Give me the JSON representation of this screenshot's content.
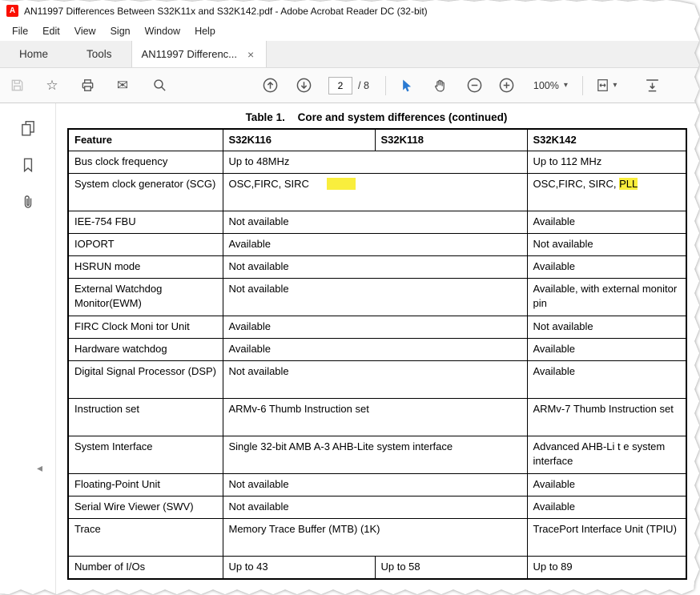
{
  "window": {
    "title": "AN11997 Differences Between S32K11x and S32K142.pdf - Adobe Acrobat Reader DC (32-bit)"
  },
  "menubar": {
    "items": [
      "File",
      "Edit",
      "View",
      "Sign",
      "Window",
      "Help"
    ]
  },
  "tabbar": {
    "home_label": "Home",
    "tools_label": "Tools",
    "document_tab_label": "AN11997 Differenc..."
  },
  "toolbar": {
    "page_current": "2",
    "page_total_label": "/ 8",
    "zoom_value": "100%"
  },
  "glyphs": {
    "star": "☆",
    "envelope": "✉",
    "caret_down": "▾",
    "collapse_left": "◂",
    "close": "×"
  },
  "document": {
    "caption_prefix": "Table 1.",
    "caption_title": "Core and system differences (continued)",
    "table": {
      "headers": [
        "Feature",
        "S32K116",
        "S32K118",
        "S32K142"
      ],
      "rows": [
        {
          "cells": [
            {
              "text": "Bus clock frequency"
            },
            {
              "text": "Up to 48MHz",
              "colspan": 2
            },
            {
              "text": "Up to 112 MHz"
            }
          ]
        },
        {
          "cells": [
            {
              "text": "System clock generator (SCG)"
            },
            {
              "segments": [
                {
                  "text": "OSC,FIRC, SIRC"
                },
                {
                  "text": "      "
                },
                {
                  "text": "          ",
                  "highlight": true
                }
              ],
              "colspan": 2
            },
            {
              "segments": [
                {
                  "text": "OSC,FIRC, SIRC, "
                },
                {
                  "text": "PLL",
                  "highlight": true
                }
              ]
            }
          ]
        },
        {
          "cells": [
            {
              "text": "IEE-754 FBU"
            },
            {
              "text": "Not available",
              "colspan": 2
            },
            {
              "text": "Available"
            }
          ]
        },
        {
          "cells": [
            {
              "text": "IOPORT"
            },
            {
              "text": "Available",
              "colspan": 2
            },
            {
              "text": "Not available"
            }
          ]
        },
        {
          "cells": [
            {
              "text": "HSRUN mode"
            },
            {
              "text": "Not available",
              "colspan": 2
            },
            {
              "text": "Available"
            }
          ]
        },
        {
          "cells": [
            {
              "text": "External Watchdog Monitor(EWM)"
            },
            {
              "text": "Not available",
              "colspan": 2
            },
            {
              "text": "Available, with external monitor pin"
            }
          ]
        },
        {
          "cells": [
            {
              "text": "FIRC Clock Moni tor Unit"
            },
            {
              "text": "Available",
              "colspan": 2
            },
            {
              "text": "Not available"
            }
          ]
        },
        {
          "cells": [
            {
              "text": "Hardware watchdog"
            },
            {
              "text": "Available",
              "colspan": 2
            },
            {
              "text": "Available"
            }
          ]
        },
        {
          "cells": [
            {
              "text": "Digital Signal Processor (DSP)"
            },
            {
              "text": "Not available",
              "colspan": 2
            },
            {
              "text": "Available"
            }
          ]
        },
        {
          "cells": [
            {
              "text": "Instruction set"
            },
            {
              "text": "ARMv-6 Thumb Instruction set",
              "colspan": 2
            },
            {
              "text": "ARMv-7 Thumb Instruction set"
            }
          ]
        },
        {
          "cells": [
            {
              "text": "System Interface"
            },
            {
              "text": "Single 32-bit AMB A-3 AHB-Lite system interface",
              "colspan": 2
            },
            {
              "text": "Advanced AHB-Li t e system interface"
            }
          ]
        },
        {
          "cells": [
            {
              "text": "Floating-Point Unit"
            },
            {
              "text": "Not available",
              "colspan": 2
            },
            {
              "text": "Available"
            }
          ]
        },
        {
          "cells": [
            {
              "text": "Serial Wire Viewer (SWV)"
            },
            {
              "text": "Not available",
              "colspan": 2
            },
            {
              "text": "Available"
            }
          ]
        },
        {
          "cells": [
            {
              "text": "Trace"
            },
            {
              "text": "Memory Trace Buffer (MTB) (1K)",
              "colspan": 2
            },
            {
              "text": "TracePort Interface Unit (TPIU)"
            }
          ]
        },
        {
          "cells": [
            {
              "text": "Number of I/Os"
            },
            {
              "text": "Up to 43"
            },
            {
              "text": "Up to 58"
            },
            {
              "text": "Up to 89"
            }
          ]
        }
      ]
    }
  },
  "colors": {
    "highlight_yellow": "#f9ee3d",
    "selection_blue": "#2a7ad2",
    "titlebar_icon_red": "#fa0f00"
  }
}
